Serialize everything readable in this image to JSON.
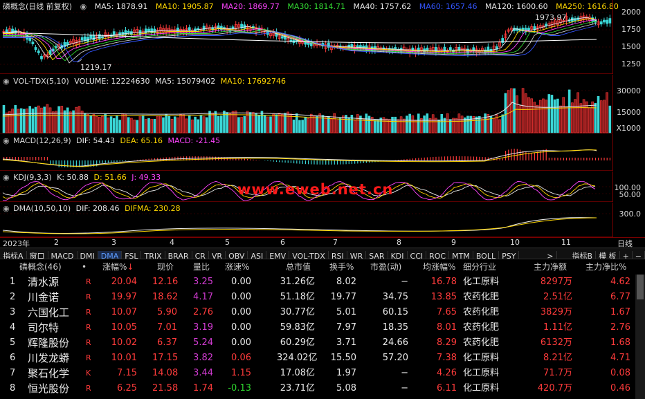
{
  "main_header": {
    "title": "磷概念(日线 前复权)",
    "ma5": "MA5: 1878.91",
    "ma10": "MA10: 1905.87",
    "ma20": "MA20: 1869.77",
    "ma30": "MA30: 1814.71",
    "ma40": "MA40: 1757.62",
    "ma60": "MA60: 1657.46",
    "ma120": "MA120: 1600.60",
    "ma250": "MA250: 1616.80"
  },
  "main_axis": [
    "2000",
    "1750",
    "1500",
    "1250"
  ],
  "main_labels": {
    "high": "1973.97",
    "low": "1219.17"
  },
  "vol_header": {
    "title": "VOL-TDX(5,10)",
    "volume": "VOLUME: 12224630",
    "ma5": "MA5: 15079402",
    "ma10": "MA10: 17692746"
  },
  "vol_axis": [
    "30000",
    "15000",
    "X1000"
  ],
  "macd_header": {
    "title": "MACD(12,26,9)",
    "dif": "DIF: 54.43",
    "dea": "DEA: 65.16",
    "macd": "MACD: -21.45"
  },
  "kdj_header": {
    "title": "KDJ(9,3,3)",
    "k": "K: 50.88",
    "d": "D: 51.66",
    "j": "J: 49.33"
  },
  "kdj_axis": [
    "100.00",
    "50.00"
  ],
  "watermark": "www.eweb.net.cn",
  "dma_header": {
    "title": "DMA(10,50,10)",
    "dif": "DIF: 208.46",
    "difma": "DIFMA: 230.28"
  },
  "dma_axis": [
    "300.0"
  ],
  "time_axis": [
    "2023年",
    "2",
    "3",
    "4",
    "5",
    "6",
    "7",
    "8",
    "9",
    "10",
    "11"
  ],
  "period_label": "日线",
  "tabs": [
    "指标A",
    "窗口",
    "MACD",
    "DMI",
    "DMA",
    "FSL",
    "TRIX",
    "BRAR",
    "CR",
    "VR",
    "OBV",
    "ASI",
    "EMV",
    "VOL-TDX",
    "RSI",
    "WR",
    "SAR",
    "KDJ",
    "CCI",
    "ROC",
    "MTM",
    "BOLL",
    "PSY"
  ],
  "tabs_right": [
    ">",
    "指标B",
    "模 板",
    "+",
    "−"
  ],
  "table": {
    "headers": [
      "磷概念(46)",
      "•",
      "涨幅%",
      "现价",
      "量比",
      "涨速%",
      "总市值",
      "换手%",
      "市盈(动)",
      "均涨幅%",
      "细分行业",
      "主力净额",
      "主力净比%"
    ],
    "rows": [
      [
        "1",
        "清水源",
        "R",
        "20.04",
        "12.16",
        "3.25",
        "0.00",
        "31.26亿",
        "8.02",
        "−",
        "16.78",
        "化工原料",
        "8297万",
        "4.62"
      ],
      [
        "2",
        "川金诺",
        "R",
        "19.97",
        "18.62",
        "4.17",
        "0.00",
        "51.18亿",
        "19.77",
        "34.75",
        "13.85",
        "农药化肥",
        "2.51亿",
        "6.77"
      ],
      [
        "3",
        "六国化工",
        "R",
        "10.07",
        "5.90",
        "2.76",
        "0.00",
        "30.77亿",
        "5.01",
        "60.15",
        "7.65",
        "农药化肥",
        "3829万",
        "1.67"
      ],
      [
        "4",
        "司尔特",
        "R",
        "10.05",
        "7.01",
        "3.19",
        "0.00",
        "59.83亿",
        "7.97",
        "18.35",
        "8.01",
        "农药化肥",
        "1.11亿",
        "2.76"
      ],
      [
        "5",
        "辉隆股份",
        "R",
        "10.02",
        "6.37",
        "5.24",
        "0.00",
        "60.29亿",
        "3.71",
        "24.66",
        "8.29",
        "农药化肥",
        "6132万",
        "1.68"
      ],
      [
        "6",
        "川发龙蟒",
        "R",
        "10.01",
        "17.15",
        "3.82",
        "0.06",
        "324.02亿",
        "15.50",
        "57.20",
        "7.38",
        "化工原料",
        "8.21亿",
        "4.71"
      ],
      [
        "7",
        "聚石化学",
        "K",
        "7.15",
        "14.08",
        "3.44",
        "1.15",
        "17.08亿",
        "1.97",
        "−",
        "4.26",
        "化工原料",
        "71.7万",
        "0.08"
      ],
      [
        "8",
        "恒光股份",
        "R",
        "6.25",
        "21.58",
        "1.74",
        "-0.13",
        "23.71亿",
        "5.08",
        "−",
        "6.11",
        "化工原料",
        "420.7万",
        "0.46"
      ]
    ]
  }
}
